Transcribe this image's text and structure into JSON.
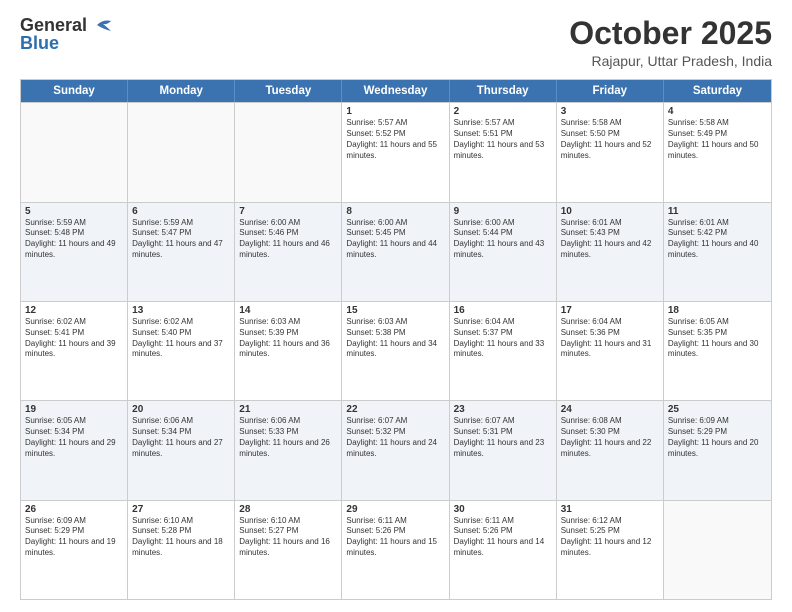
{
  "header": {
    "logo_general": "General",
    "logo_blue": "Blue",
    "month_title": "October 2025",
    "location": "Rajapur, Uttar Pradesh, India"
  },
  "weekdays": [
    "Sunday",
    "Monday",
    "Tuesday",
    "Wednesday",
    "Thursday",
    "Friday",
    "Saturday"
  ],
  "weeks": [
    [
      {
        "day": "",
        "sunrise": "",
        "sunset": "",
        "daylight": "",
        "empty": true
      },
      {
        "day": "",
        "sunrise": "",
        "sunset": "",
        "daylight": "",
        "empty": true
      },
      {
        "day": "",
        "sunrise": "",
        "sunset": "",
        "daylight": "",
        "empty": true
      },
      {
        "day": "1",
        "sunrise": "Sunrise: 5:57 AM",
        "sunset": "Sunset: 5:52 PM",
        "daylight": "Daylight: 11 hours and 55 minutes."
      },
      {
        "day": "2",
        "sunrise": "Sunrise: 5:57 AM",
        "sunset": "Sunset: 5:51 PM",
        "daylight": "Daylight: 11 hours and 53 minutes."
      },
      {
        "day": "3",
        "sunrise": "Sunrise: 5:58 AM",
        "sunset": "Sunset: 5:50 PM",
        "daylight": "Daylight: 11 hours and 52 minutes."
      },
      {
        "day": "4",
        "sunrise": "Sunrise: 5:58 AM",
        "sunset": "Sunset: 5:49 PM",
        "daylight": "Daylight: 11 hours and 50 minutes."
      }
    ],
    [
      {
        "day": "5",
        "sunrise": "Sunrise: 5:59 AM",
        "sunset": "Sunset: 5:48 PM",
        "daylight": "Daylight: 11 hours and 49 minutes."
      },
      {
        "day": "6",
        "sunrise": "Sunrise: 5:59 AM",
        "sunset": "Sunset: 5:47 PM",
        "daylight": "Daylight: 11 hours and 47 minutes."
      },
      {
        "day": "7",
        "sunrise": "Sunrise: 6:00 AM",
        "sunset": "Sunset: 5:46 PM",
        "daylight": "Daylight: 11 hours and 46 minutes."
      },
      {
        "day": "8",
        "sunrise": "Sunrise: 6:00 AM",
        "sunset": "Sunset: 5:45 PM",
        "daylight": "Daylight: 11 hours and 44 minutes."
      },
      {
        "day": "9",
        "sunrise": "Sunrise: 6:00 AM",
        "sunset": "Sunset: 5:44 PM",
        "daylight": "Daylight: 11 hours and 43 minutes."
      },
      {
        "day": "10",
        "sunrise": "Sunrise: 6:01 AM",
        "sunset": "Sunset: 5:43 PM",
        "daylight": "Daylight: 11 hours and 42 minutes."
      },
      {
        "day": "11",
        "sunrise": "Sunrise: 6:01 AM",
        "sunset": "Sunset: 5:42 PM",
        "daylight": "Daylight: 11 hours and 40 minutes."
      }
    ],
    [
      {
        "day": "12",
        "sunrise": "Sunrise: 6:02 AM",
        "sunset": "Sunset: 5:41 PM",
        "daylight": "Daylight: 11 hours and 39 minutes."
      },
      {
        "day": "13",
        "sunrise": "Sunrise: 6:02 AM",
        "sunset": "Sunset: 5:40 PM",
        "daylight": "Daylight: 11 hours and 37 minutes."
      },
      {
        "day": "14",
        "sunrise": "Sunrise: 6:03 AM",
        "sunset": "Sunset: 5:39 PM",
        "daylight": "Daylight: 11 hours and 36 minutes."
      },
      {
        "day": "15",
        "sunrise": "Sunrise: 6:03 AM",
        "sunset": "Sunset: 5:38 PM",
        "daylight": "Daylight: 11 hours and 34 minutes."
      },
      {
        "day": "16",
        "sunrise": "Sunrise: 6:04 AM",
        "sunset": "Sunset: 5:37 PM",
        "daylight": "Daylight: 11 hours and 33 minutes."
      },
      {
        "day": "17",
        "sunrise": "Sunrise: 6:04 AM",
        "sunset": "Sunset: 5:36 PM",
        "daylight": "Daylight: 11 hours and 31 minutes."
      },
      {
        "day": "18",
        "sunrise": "Sunrise: 6:05 AM",
        "sunset": "Sunset: 5:35 PM",
        "daylight": "Daylight: 11 hours and 30 minutes."
      }
    ],
    [
      {
        "day": "19",
        "sunrise": "Sunrise: 6:05 AM",
        "sunset": "Sunset: 5:34 PM",
        "daylight": "Daylight: 11 hours and 29 minutes."
      },
      {
        "day": "20",
        "sunrise": "Sunrise: 6:06 AM",
        "sunset": "Sunset: 5:34 PM",
        "daylight": "Daylight: 11 hours and 27 minutes."
      },
      {
        "day": "21",
        "sunrise": "Sunrise: 6:06 AM",
        "sunset": "Sunset: 5:33 PM",
        "daylight": "Daylight: 11 hours and 26 minutes."
      },
      {
        "day": "22",
        "sunrise": "Sunrise: 6:07 AM",
        "sunset": "Sunset: 5:32 PM",
        "daylight": "Daylight: 11 hours and 24 minutes."
      },
      {
        "day": "23",
        "sunrise": "Sunrise: 6:07 AM",
        "sunset": "Sunset: 5:31 PM",
        "daylight": "Daylight: 11 hours and 23 minutes."
      },
      {
        "day": "24",
        "sunrise": "Sunrise: 6:08 AM",
        "sunset": "Sunset: 5:30 PM",
        "daylight": "Daylight: 11 hours and 22 minutes."
      },
      {
        "day": "25",
        "sunrise": "Sunrise: 6:09 AM",
        "sunset": "Sunset: 5:29 PM",
        "daylight": "Daylight: 11 hours and 20 minutes."
      }
    ],
    [
      {
        "day": "26",
        "sunrise": "Sunrise: 6:09 AM",
        "sunset": "Sunset: 5:29 PM",
        "daylight": "Daylight: 11 hours and 19 minutes."
      },
      {
        "day": "27",
        "sunrise": "Sunrise: 6:10 AM",
        "sunset": "Sunset: 5:28 PM",
        "daylight": "Daylight: 11 hours and 18 minutes."
      },
      {
        "day": "28",
        "sunrise": "Sunrise: 6:10 AM",
        "sunset": "Sunset: 5:27 PM",
        "daylight": "Daylight: 11 hours and 16 minutes."
      },
      {
        "day": "29",
        "sunrise": "Sunrise: 6:11 AM",
        "sunset": "Sunset: 5:26 PM",
        "daylight": "Daylight: 11 hours and 15 minutes."
      },
      {
        "day": "30",
        "sunrise": "Sunrise: 6:11 AM",
        "sunset": "Sunset: 5:26 PM",
        "daylight": "Daylight: 11 hours and 14 minutes."
      },
      {
        "day": "31",
        "sunrise": "Sunrise: 6:12 AM",
        "sunset": "Sunset: 5:25 PM",
        "daylight": "Daylight: 11 hours and 12 minutes."
      },
      {
        "day": "",
        "sunrise": "",
        "sunset": "",
        "daylight": "",
        "empty": true
      }
    ]
  ]
}
